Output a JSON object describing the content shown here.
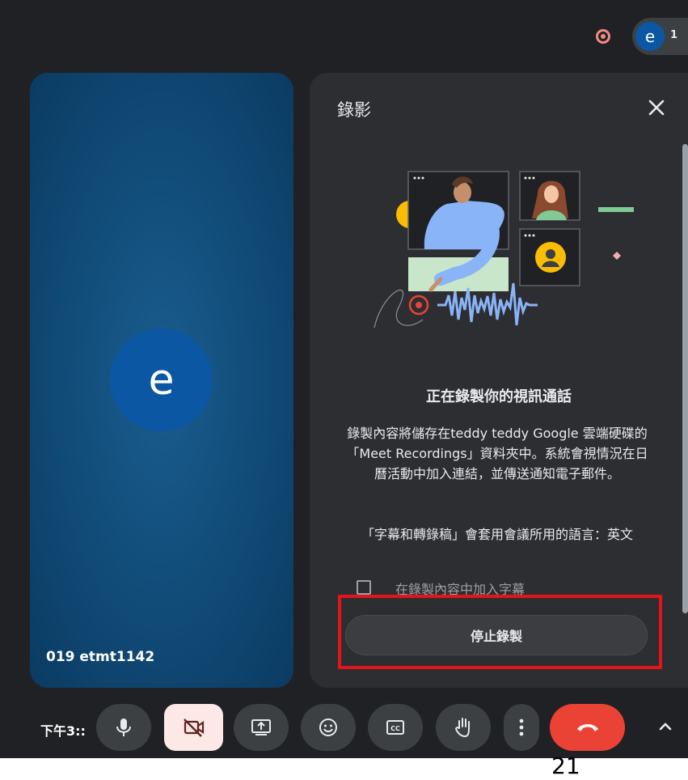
{
  "topbar": {
    "people_avatar_letter": "e",
    "people_count": "1",
    "recording_indicator_color": "#f28b82"
  },
  "tile": {
    "avatar_letter": "e",
    "participant_name": "019 etmt1142",
    "avatar_color": "#0b57a4"
  },
  "panel": {
    "title": "錄影",
    "heading": "正在錄製你的視訊通話",
    "description": "錄製內容將儲存在teddy teddy Google 雲端硬碟的「Meet Recordings」資料夾中。系統會視情況在日曆活動中加入連結，並傳送通知電子郵件。",
    "language_note": "「字幕和轉錄稿」會套用會議所用的語言：英文",
    "caption_checkbox_label": "在錄製內容中加入字幕",
    "caption_checked": false,
    "stop_button": "停止錄製"
  },
  "controls": {
    "clock": "下午3::",
    "icons": [
      "mic-icon",
      "camera-off-icon",
      "present-screen-icon",
      "emoji-icon",
      "captions-icon",
      "raise-hand-icon",
      "more-options-icon",
      "end-call-icon",
      "chevron-up-icon"
    ],
    "end_call_color": "#ea4335",
    "camera_off_bg": "#fce8e6"
  },
  "annotation": {
    "highlight_color": "#e2141c",
    "page_number": "21"
  }
}
